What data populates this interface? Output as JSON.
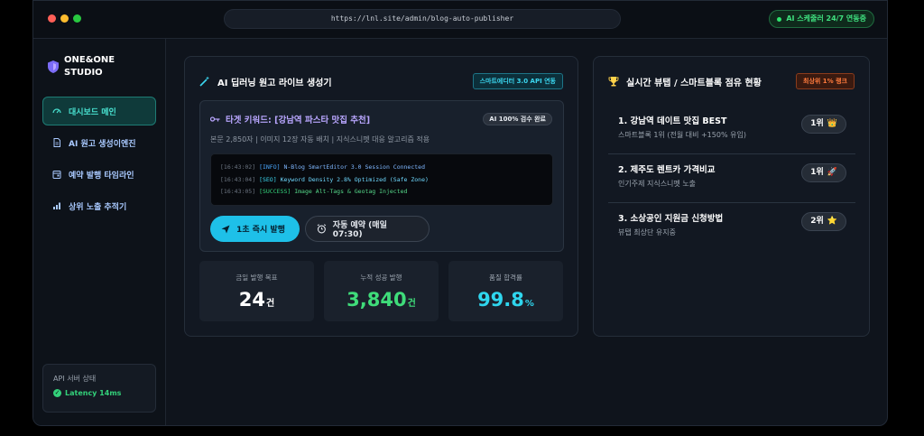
{
  "browser": {
    "url": "https://lnl.site/admin/blog-auto-publisher",
    "status_pill": "AI 스케줄러 24/7 연동중"
  },
  "sidebar": {
    "brand_line1": "ONE&ONE",
    "brand_line2": "STUDIO",
    "items": [
      {
        "label": "대시보드 메인",
        "icon": "gauge-icon",
        "active": true
      },
      {
        "label": "AI 원고 생성이엔진",
        "icon": "document-icon",
        "active": false
      },
      {
        "label": "예약 발행 타임라인",
        "icon": "calendar-icon",
        "active": false
      },
      {
        "label": "상위 노출 추적기",
        "icon": "bar-chart-icon",
        "active": false
      }
    ],
    "server": {
      "label": "API 서버 상태",
      "value": "Latency 14ms"
    }
  },
  "generator": {
    "title": "AI 딥러닝 원고 라이브 생성기",
    "badge": "스마트에디터 3.0 API 연동",
    "target_title": "타겟 키워드: [강남역 파스타 맛집 추천]",
    "review_badge": "AI 100% 검수 완료",
    "meta": "본문 2,850자  |  이미지 12장 자동 배치  |  지식스니펫 대응 알고리즘 적용",
    "logs": [
      {
        "time": "[16:43:02]",
        "tag": "[INFO]",
        "msg": "N-Blog SmartEditor 3.0 Session Connected"
      },
      {
        "time": "[16:43:04]",
        "tag": "[SEO]",
        "msg": "Keyword Density 2.8% Optimized (Safe Zone)"
      },
      {
        "time": "[16:43:05]",
        "tag": "[SUCCESS]",
        "msg": "Image Alt-Tags & Geotag Injected"
      }
    ],
    "publish_button": "1초 즉시 발행",
    "schedule_button": "자동 예약 (매일 07:30)"
  },
  "stats": [
    {
      "label": "금일 발행 목표",
      "value": "24",
      "unit": "건",
      "color": "#ffffff"
    },
    {
      "label": "누적 성공 발행",
      "value": "3,840",
      "unit": "건",
      "color": "#3fdc7a"
    },
    {
      "label": "품질 합격률",
      "value": "99.8",
      "unit": "%",
      "color": "#2fd6ee"
    }
  ],
  "ranking": {
    "title": "실시간 뷰탭 / 스마트블록 점유 현황",
    "badge": "최상위 1% 랭크",
    "items": [
      {
        "title": "1. 강남역 데이트 맛집 BEST",
        "sub": "스마트블록 1위 (전월 대비 +150% 유입)",
        "rank": "1위",
        "emoji": "👑"
      },
      {
        "title": "2. 제주도 렌트카 가격비교",
        "sub": "인기주제 지식스니펫 노출",
        "rank": "1위",
        "emoji": "🚀"
      },
      {
        "title": "3. 소상공인 지원금 신청방법",
        "sub": "뷰탭 최상단 유지중",
        "rank": "2위",
        "emoji": "⭐"
      }
    ]
  },
  "colors": {
    "accent": "#1ec0e8",
    "active_nav": "#48e0cf",
    "success": "#33d17a",
    "warning": "#ff7b3d",
    "keyword": "#b9a6ff"
  }
}
